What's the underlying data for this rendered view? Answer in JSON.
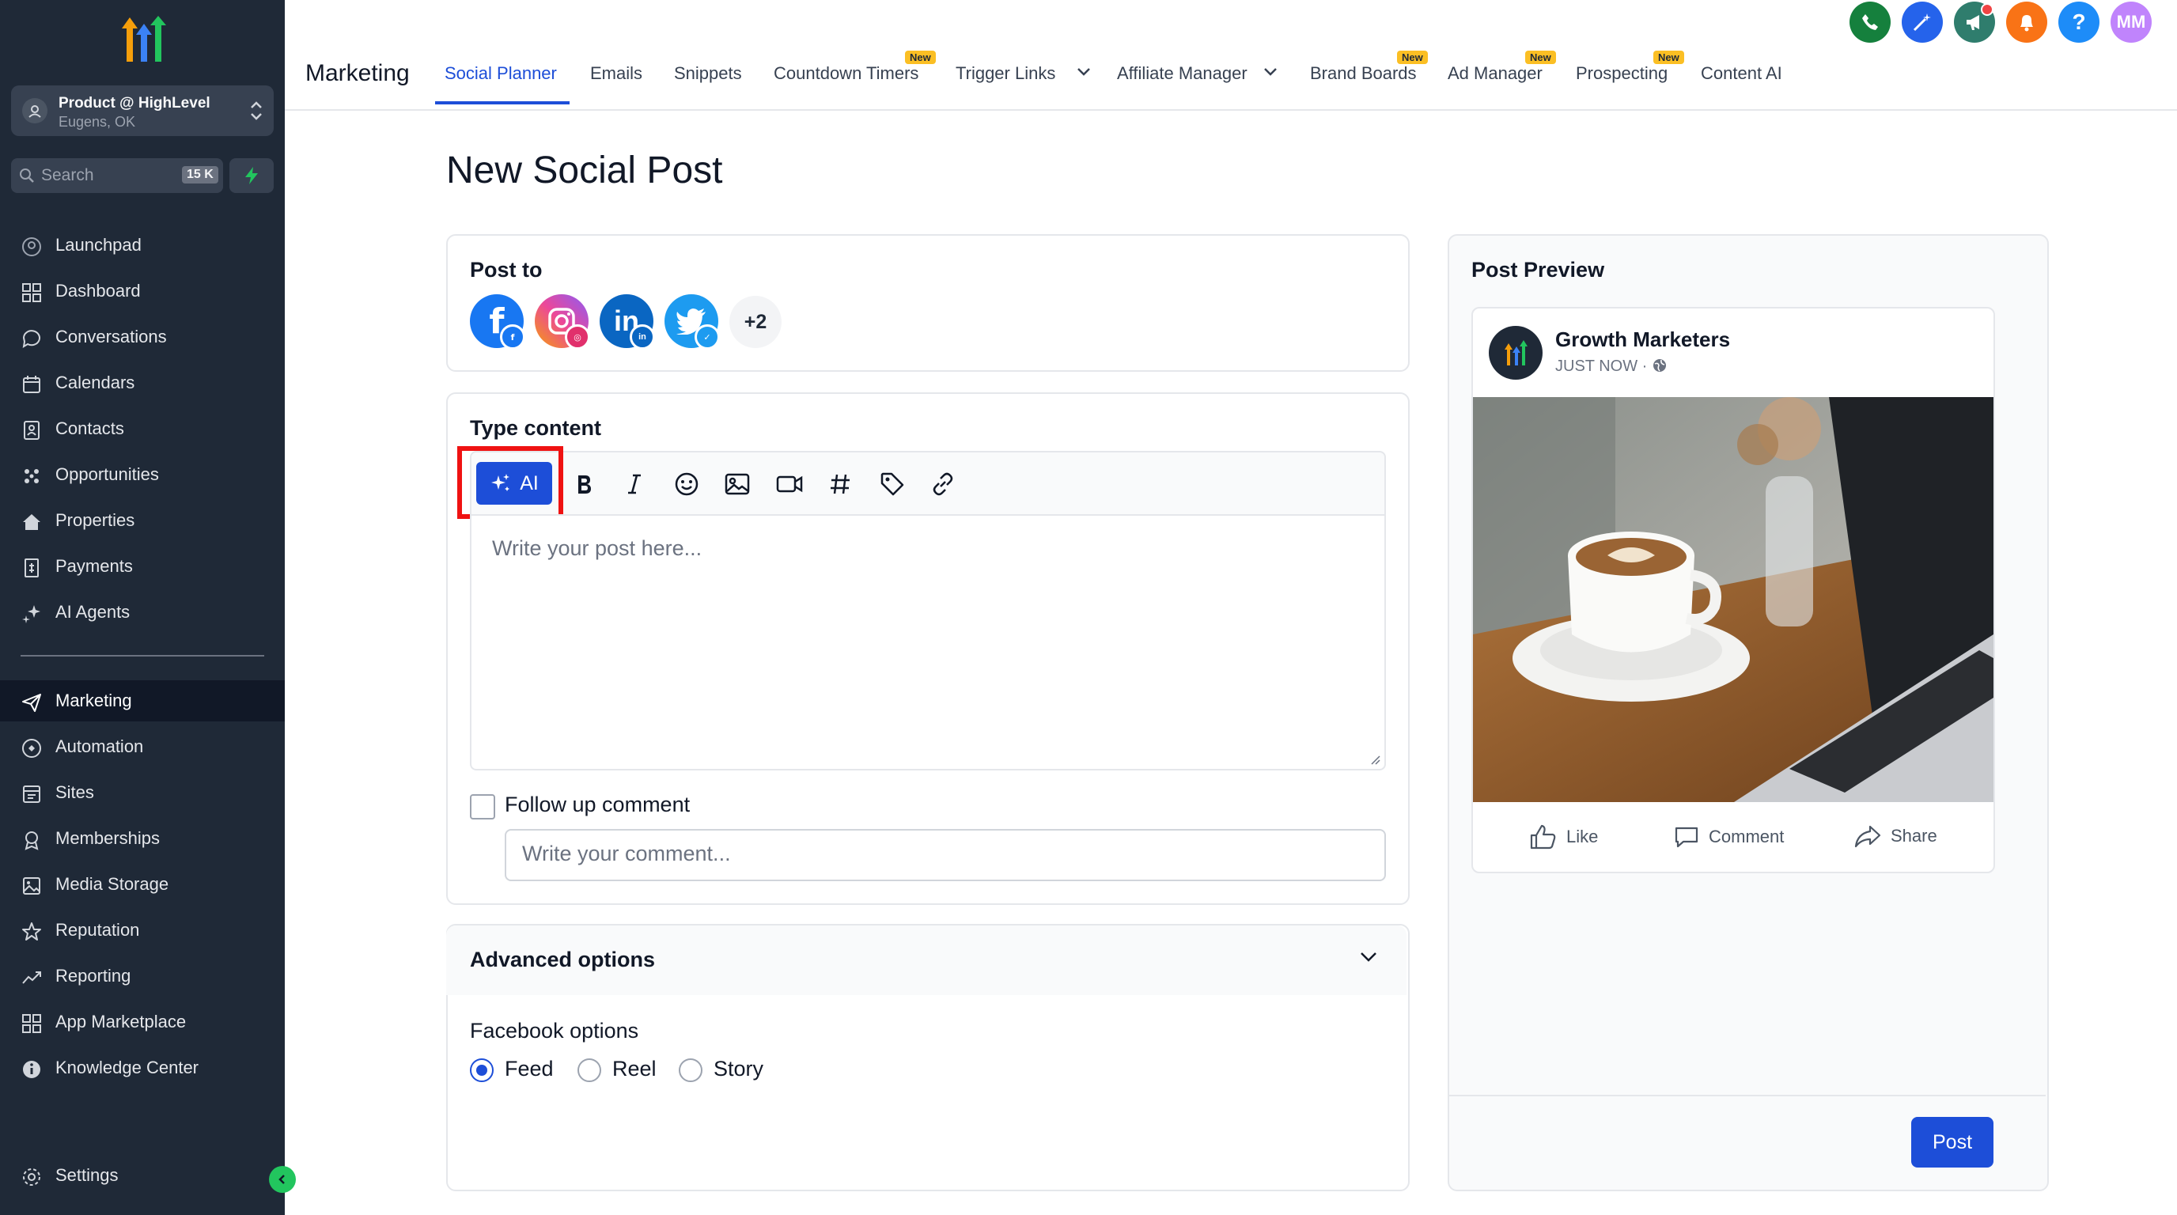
{
  "sidebar": {
    "account": {
      "name": "Product @ HighLevel",
      "location": "Eugens, OK"
    },
    "search": {
      "placeholder": "Search",
      "shortcut": "15 K"
    },
    "items": [
      {
        "label": "Launchpad",
        "icon": "rocket-icon"
      },
      {
        "label": "Dashboard",
        "icon": "grid-icon"
      },
      {
        "label": "Conversations",
        "icon": "chat-icon"
      },
      {
        "label": "Calendars",
        "icon": "calendar-icon"
      },
      {
        "label": "Contacts",
        "icon": "contacts-icon"
      },
      {
        "label": "Opportunities",
        "icon": "opportunities-icon"
      },
      {
        "label": "Properties",
        "icon": "home-icon"
      },
      {
        "label": "Payments",
        "icon": "payments-icon"
      },
      {
        "label": "AI Agents",
        "icon": "sparkle-icon"
      }
    ],
    "items2": [
      {
        "label": "Marketing",
        "icon": "send-icon",
        "active": true
      },
      {
        "label": "Automation",
        "icon": "automation-icon"
      },
      {
        "label": "Sites",
        "icon": "sites-icon"
      },
      {
        "label": "Memberships",
        "icon": "membership-icon"
      },
      {
        "label": "Media Storage",
        "icon": "media-icon"
      },
      {
        "label": "Reputation",
        "icon": "star-icon"
      },
      {
        "label": "Reporting",
        "icon": "chart-line-icon"
      },
      {
        "label": "App Marketplace",
        "icon": "apps-icon"
      },
      {
        "label": "Knowledge Center",
        "icon": "info-icon"
      }
    ],
    "settings_label": "Settings"
  },
  "topbar": {
    "section": "Marketing",
    "tabs": [
      {
        "label": "Social Planner",
        "active": true
      },
      {
        "label": "Emails"
      },
      {
        "label": "Snippets"
      },
      {
        "label": "Countdown Timers",
        "badge": "New"
      },
      {
        "label": "Trigger Links"
      },
      {
        "label": "Affiliate Manager"
      },
      {
        "label": "Brand Boards",
        "badge": "New"
      },
      {
        "label": "Ad Manager",
        "badge": "New"
      },
      {
        "label": "Prospecting",
        "badge": "New"
      },
      {
        "label": "Content AI"
      }
    ],
    "avatar_initials": "MM",
    "help_label": "?"
  },
  "main": {
    "title": "New Social Post",
    "post_to": {
      "label": "Post to",
      "more": "+2"
    },
    "content": {
      "label": "Type content",
      "ai_label": "AI",
      "placeholder": "Write your post here..."
    },
    "follow_up": {
      "label": "Follow up comment",
      "placeholder": "Write your comment..."
    },
    "advanced": {
      "label": "Advanced options",
      "facebook_label": "Facebook options",
      "options": [
        "Feed",
        "Reel",
        "Story"
      ],
      "selected": "Feed"
    }
  },
  "preview": {
    "title": "Post Preview",
    "account_name": "Growth Marketers",
    "timestamp": "JUST NOW ·",
    "actions": [
      "Like",
      "Comment",
      "Share"
    ],
    "post_button": "Post"
  },
  "colors": {
    "accent": "#1d4ed8",
    "sidebar": "#1f2937",
    "highlight": "#ef1212"
  }
}
